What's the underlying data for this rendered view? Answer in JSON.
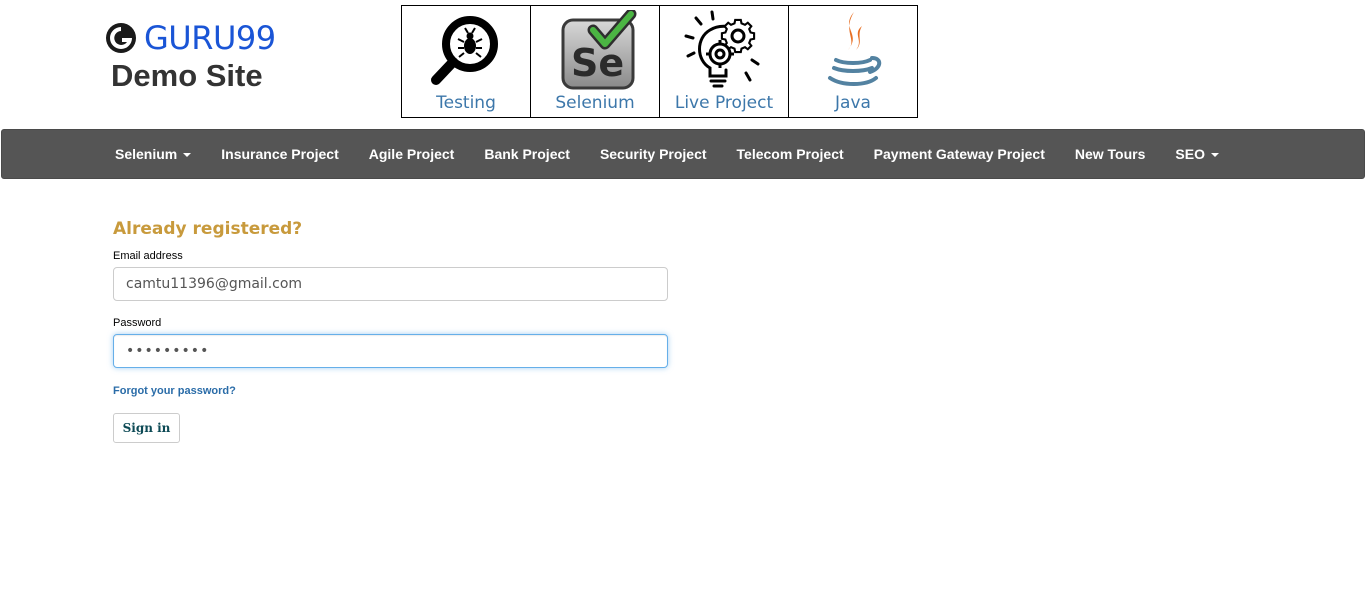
{
  "brand": {
    "name": "GURU99",
    "site_name": "Demo Site",
    "brand_color": "#1a55d6"
  },
  "tiles": [
    {
      "label": "Testing",
      "icon": "magnifier-bug-icon"
    },
    {
      "label": "Selenium",
      "icon": "selenium-logo-icon"
    },
    {
      "label": "Live Project",
      "icon": "lightbulb-gears-icon"
    },
    {
      "label": "Java",
      "icon": "java-cup-icon"
    }
  ],
  "nav": {
    "background": "#555555",
    "items": [
      {
        "label": "Selenium",
        "dropdown": true
      },
      {
        "label": "Insurance Project",
        "dropdown": false
      },
      {
        "label": "Agile Project",
        "dropdown": false
      },
      {
        "label": "Bank Project",
        "dropdown": false
      },
      {
        "label": "Security Project",
        "dropdown": false
      },
      {
        "label": "Telecom Project",
        "dropdown": false
      },
      {
        "label": "Payment Gateway Project",
        "dropdown": false
      },
      {
        "label": "New Tours",
        "dropdown": false
      },
      {
        "label": "SEO",
        "dropdown": true
      }
    ]
  },
  "login": {
    "title": "Already registered?",
    "title_color": "#c89a3c",
    "email_label": "Email address",
    "email_value": "camtu11396@gmail.com",
    "password_label": "Password",
    "password_value": "•••••••••",
    "forgot_link": "Forgot your password?",
    "signin_label": "Sign in"
  }
}
